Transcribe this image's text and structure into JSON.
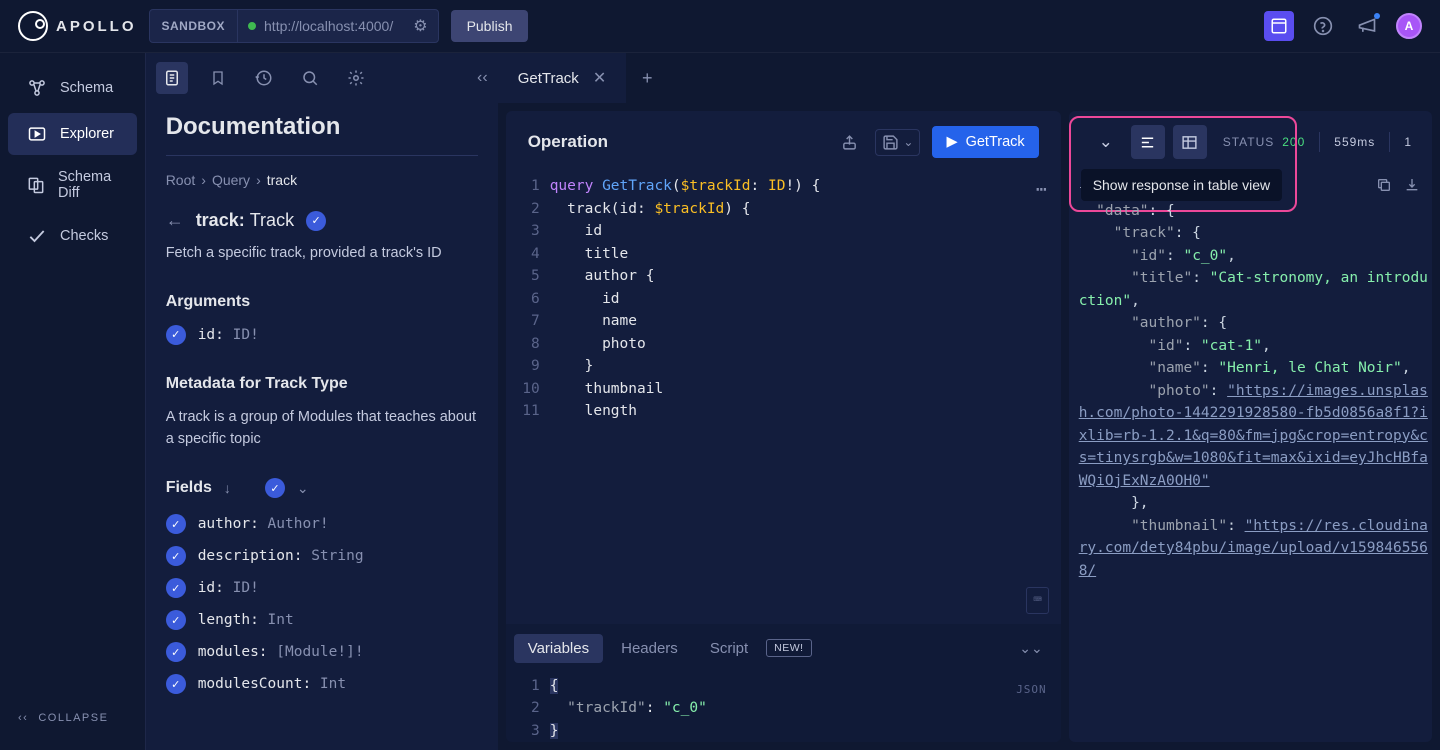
{
  "header": {
    "brand": "APOLLO",
    "envLabel": "SANDBOX",
    "url": "http://localhost:4000/",
    "publish": "Publish",
    "avatar": "A"
  },
  "sidenav": {
    "items": [
      "Schema",
      "Explorer",
      "Schema Diff",
      "Checks"
    ],
    "collapse": "COLLAPSE"
  },
  "docs": {
    "title": "Documentation",
    "crumbs": [
      "Root",
      "Query",
      "track"
    ],
    "item_name": "track:",
    "item_type": "Track",
    "item_desc": "Fetch a specific track, provided a track's ID",
    "arguments_h": "Arguments",
    "args": [
      {
        "name": "id:",
        "type": "ID!"
      }
    ],
    "metadata_h": "Metadata for Track Type",
    "metadata_desc": "A track is a group of Modules that teaches about a specific topic",
    "fields_h": "Fields",
    "fields": [
      {
        "name": "author:",
        "type": "Author!"
      },
      {
        "name": "description:",
        "type": "String"
      },
      {
        "name": "id:",
        "type": "ID!"
      },
      {
        "name": "length:",
        "type": "Int"
      },
      {
        "name": "modules:",
        "type": "[Module!]!"
      },
      {
        "name": "modulesCount:",
        "type": "Int"
      }
    ]
  },
  "tabs": {
    "active": "GetTrack"
  },
  "operation": {
    "title": "Operation",
    "runLabel": "GetTrack",
    "code": {
      "kw_query": "query",
      "name": "GetTrack",
      "var": "$trackId",
      "vartype": "ID",
      "lines": [
        "id",
        "title",
        "author",
        "id",
        "name",
        "photo",
        "thumbnail",
        "length"
      ]
    }
  },
  "variables": {
    "tabs": [
      "Variables",
      "Headers",
      "Script"
    ],
    "newBadge": "NEW!",
    "jsonLabel": "JSON",
    "key": "\"trackId\"",
    "val": "\"c_0\""
  },
  "response": {
    "tooltip": "Show response in table view",
    "statusLabel": "STATUS",
    "statusCode": "200",
    "timing": "559ms",
    "count": "1",
    "data": {
      "id": "\"c_0\"",
      "title": "\"Cat-stronomy, an introduction\"",
      "author_id": "\"cat-1\"",
      "author_name": "\"Henri, le Chat Noir\"",
      "photo": "\"https://images.unsplash.com/photo-1442291928580-fb5d0856a8f1?ixlib=rb-1.2.1&q=80&fm=jpg&crop=entropy&cs=tinysrgb&w=1080&fit=max&ixid=eyJhcHBfaWQiOjExNzA0OH0\"",
      "thumb": "\"https://res.cloudinary.com/dety84pbu/image/upload/v1598465568/"
    }
  }
}
